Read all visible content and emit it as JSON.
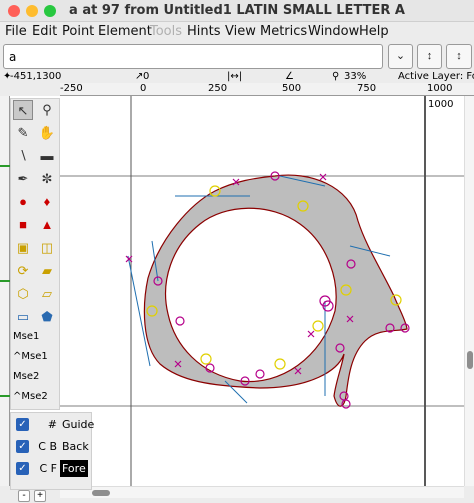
{
  "window": {
    "title": "a at 97 from Untitled1 LATIN SMALL LETTER A",
    "traffic_lights": [
      "#ff5f57",
      "#febc2e",
      "#28c840"
    ]
  },
  "menu": [
    "File",
    "Edit",
    "Point",
    "Element",
    "Tools",
    "Hints",
    "View",
    "Metrics",
    "Window",
    "Help"
  ],
  "menu_disabled": "Tools",
  "glyph_input": {
    "value": "a"
  },
  "toolbar_buttons": [
    "chevron-down-icon",
    "updown-arrow-icon",
    "updown-arrow-icon"
  ],
  "status": {
    "coords": "-451,1300",
    "pos2": "0",
    "zoom": "33%",
    "active_layer": "Active Layer: Fore"
  },
  "ruler": {
    "ticks": [
      "-250",
      "0",
      "250",
      "500",
      "750",
      "1000"
    ]
  },
  "canvas": {
    "em_label": "1000",
    "fill_color": "#bdbdbd",
    "outline_color": "#8b0000",
    "point_color": "#b5008a",
    "control_color": "#1f6fb0",
    "extrema_color": "#e0d000"
  },
  "tools": {
    "mse_labels": [
      "Mse1",
      "^Mse1",
      "Mse2",
      "^Mse2"
    ]
  },
  "layers": [
    {
      "code": "#",
      "name": "Guide",
      "checked": true,
      "active": false
    },
    {
      "code": "C B",
      "name": "Back",
      "checked": true,
      "active": false
    },
    {
      "code": "C F",
      "name": "Fore",
      "checked": true,
      "active": true
    }
  ],
  "layer_footer": [
    "-",
    "+"
  ]
}
